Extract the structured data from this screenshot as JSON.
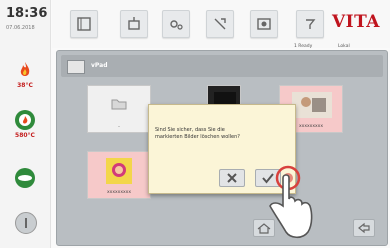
{
  "status": {
    "time": "18:36",
    "date": "07.06.2018",
    "temp_top": "38°C",
    "temp_bottom": "580°C"
  },
  "brand": {
    "logo": "VITA",
    "accent": "#c0141e"
  },
  "subheader": {
    "left": "1 Ready",
    "right": "Lokal"
  },
  "panel": {
    "title": "vPad",
    "tiles": [
      {
        "name": "..",
        "kind": "folder"
      },
      {
        "name": "",
        "kind": "image-dark"
      },
      {
        "name": "xxxxxxxxx",
        "kind": "image-photo"
      },
      {
        "name": "xxxxxxxxx",
        "kind": "image-comic"
      }
    ]
  },
  "dialog": {
    "message": "Sind Sie sicher, dass Sie die markierten Bilder löschen wollen?",
    "cancel_icon": "close-icon",
    "confirm_icon": "check-icon"
  },
  "icons": {
    "toolbar": [
      "program-icon",
      "tools-icon",
      "settings-icon",
      "service-icon",
      "media-icon",
      "help-icon"
    ],
    "left": [
      "flame-icon",
      "vacuum-icon",
      "pump-icon",
      "power-icon"
    ],
    "nav": [
      "home-icon",
      "back-icon"
    ]
  }
}
